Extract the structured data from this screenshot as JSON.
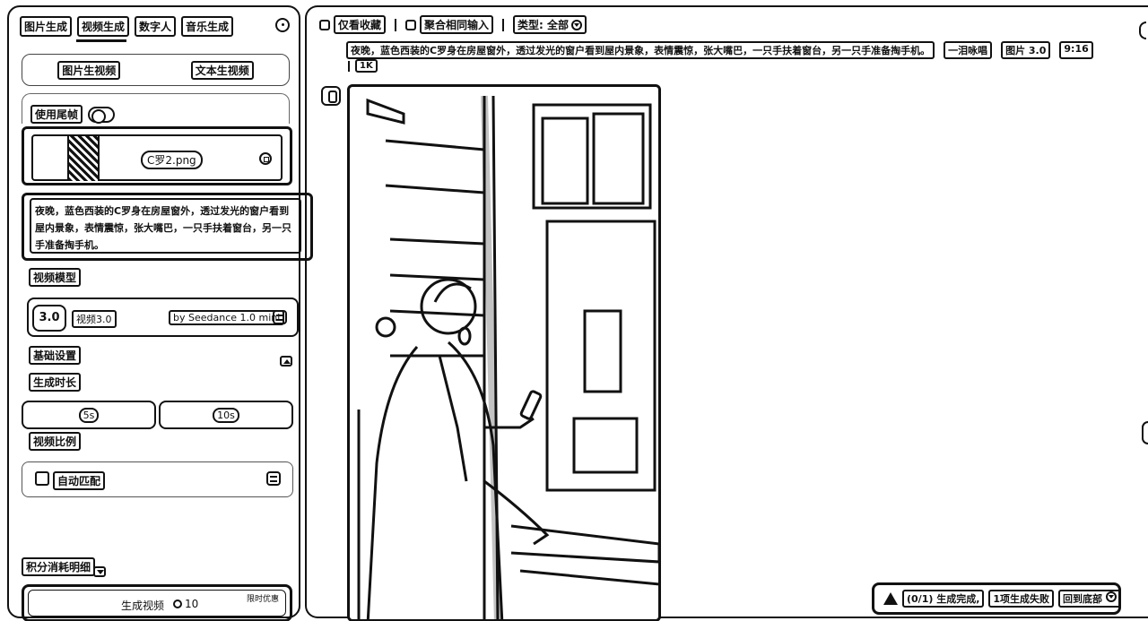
{
  "left": {
    "tabs": [
      "图片生成",
      "视频生成",
      "数字人",
      "音乐生成"
    ],
    "active_tab": "视频生成",
    "mode": {
      "image_to_video": "图片生视频",
      "text_to_video": "文本生视频"
    },
    "use_tail_frame": "使用尾帧",
    "upload": {
      "file_name": "C罗2.png"
    },
    "prompt": "夜晚，蓝色西装的C罗身在房屋窗外，透过发光的窗户看到屋内景象，表情震惊，张大嘴巴，一只手扶着窗台，另一只手准备掏手机。",
    "video_model_label": "视频模型",
    "model": {
      "logo": "3.0",
      "name": "视频3.0",
      "by": "by Seedance 1.0 mini"
    },
    "basic_settings": "基础设置",
    "duration_label": "生成时长",
    "durations": [
      "5s",
      "10s"
    ],
    "ratio_label": "视频比例",
    "ratio_value": "自动匹配",
    "points_detail": "积分消耗明细",
    "generate": {
      "label": "生成视频",
      "cost": "10",
      "badge": "限时优惠"
    }
  },
  "right": {
    "filters": {
      "favorites_only": "仅看收藏",
      "merge_inputs": "聚合相同输入",
      "type": "类型: 全部"
    },
    "record": {
      "prompt": "夜晚，蓝色西装的C罗身在房屋窗外，透过发光的窗户看到屋内景象，表情震惊，张大嘴巴，一只手扶着窗台，另一只手准备掏手机。",
      "style": "一泪咏唱",
      "model": "图片 3.0",
      "ratio": "9:16",
      "resolution": "1K"
    },
    "status": {
      "progress": "(0/1) 生成完成,",
      "failed": "1项生成失败",
      "scroll": "回到底部"
    }
  },
  "colors": {
    "ink": "#111111",
    "background": "#ffffff"
  }
}
